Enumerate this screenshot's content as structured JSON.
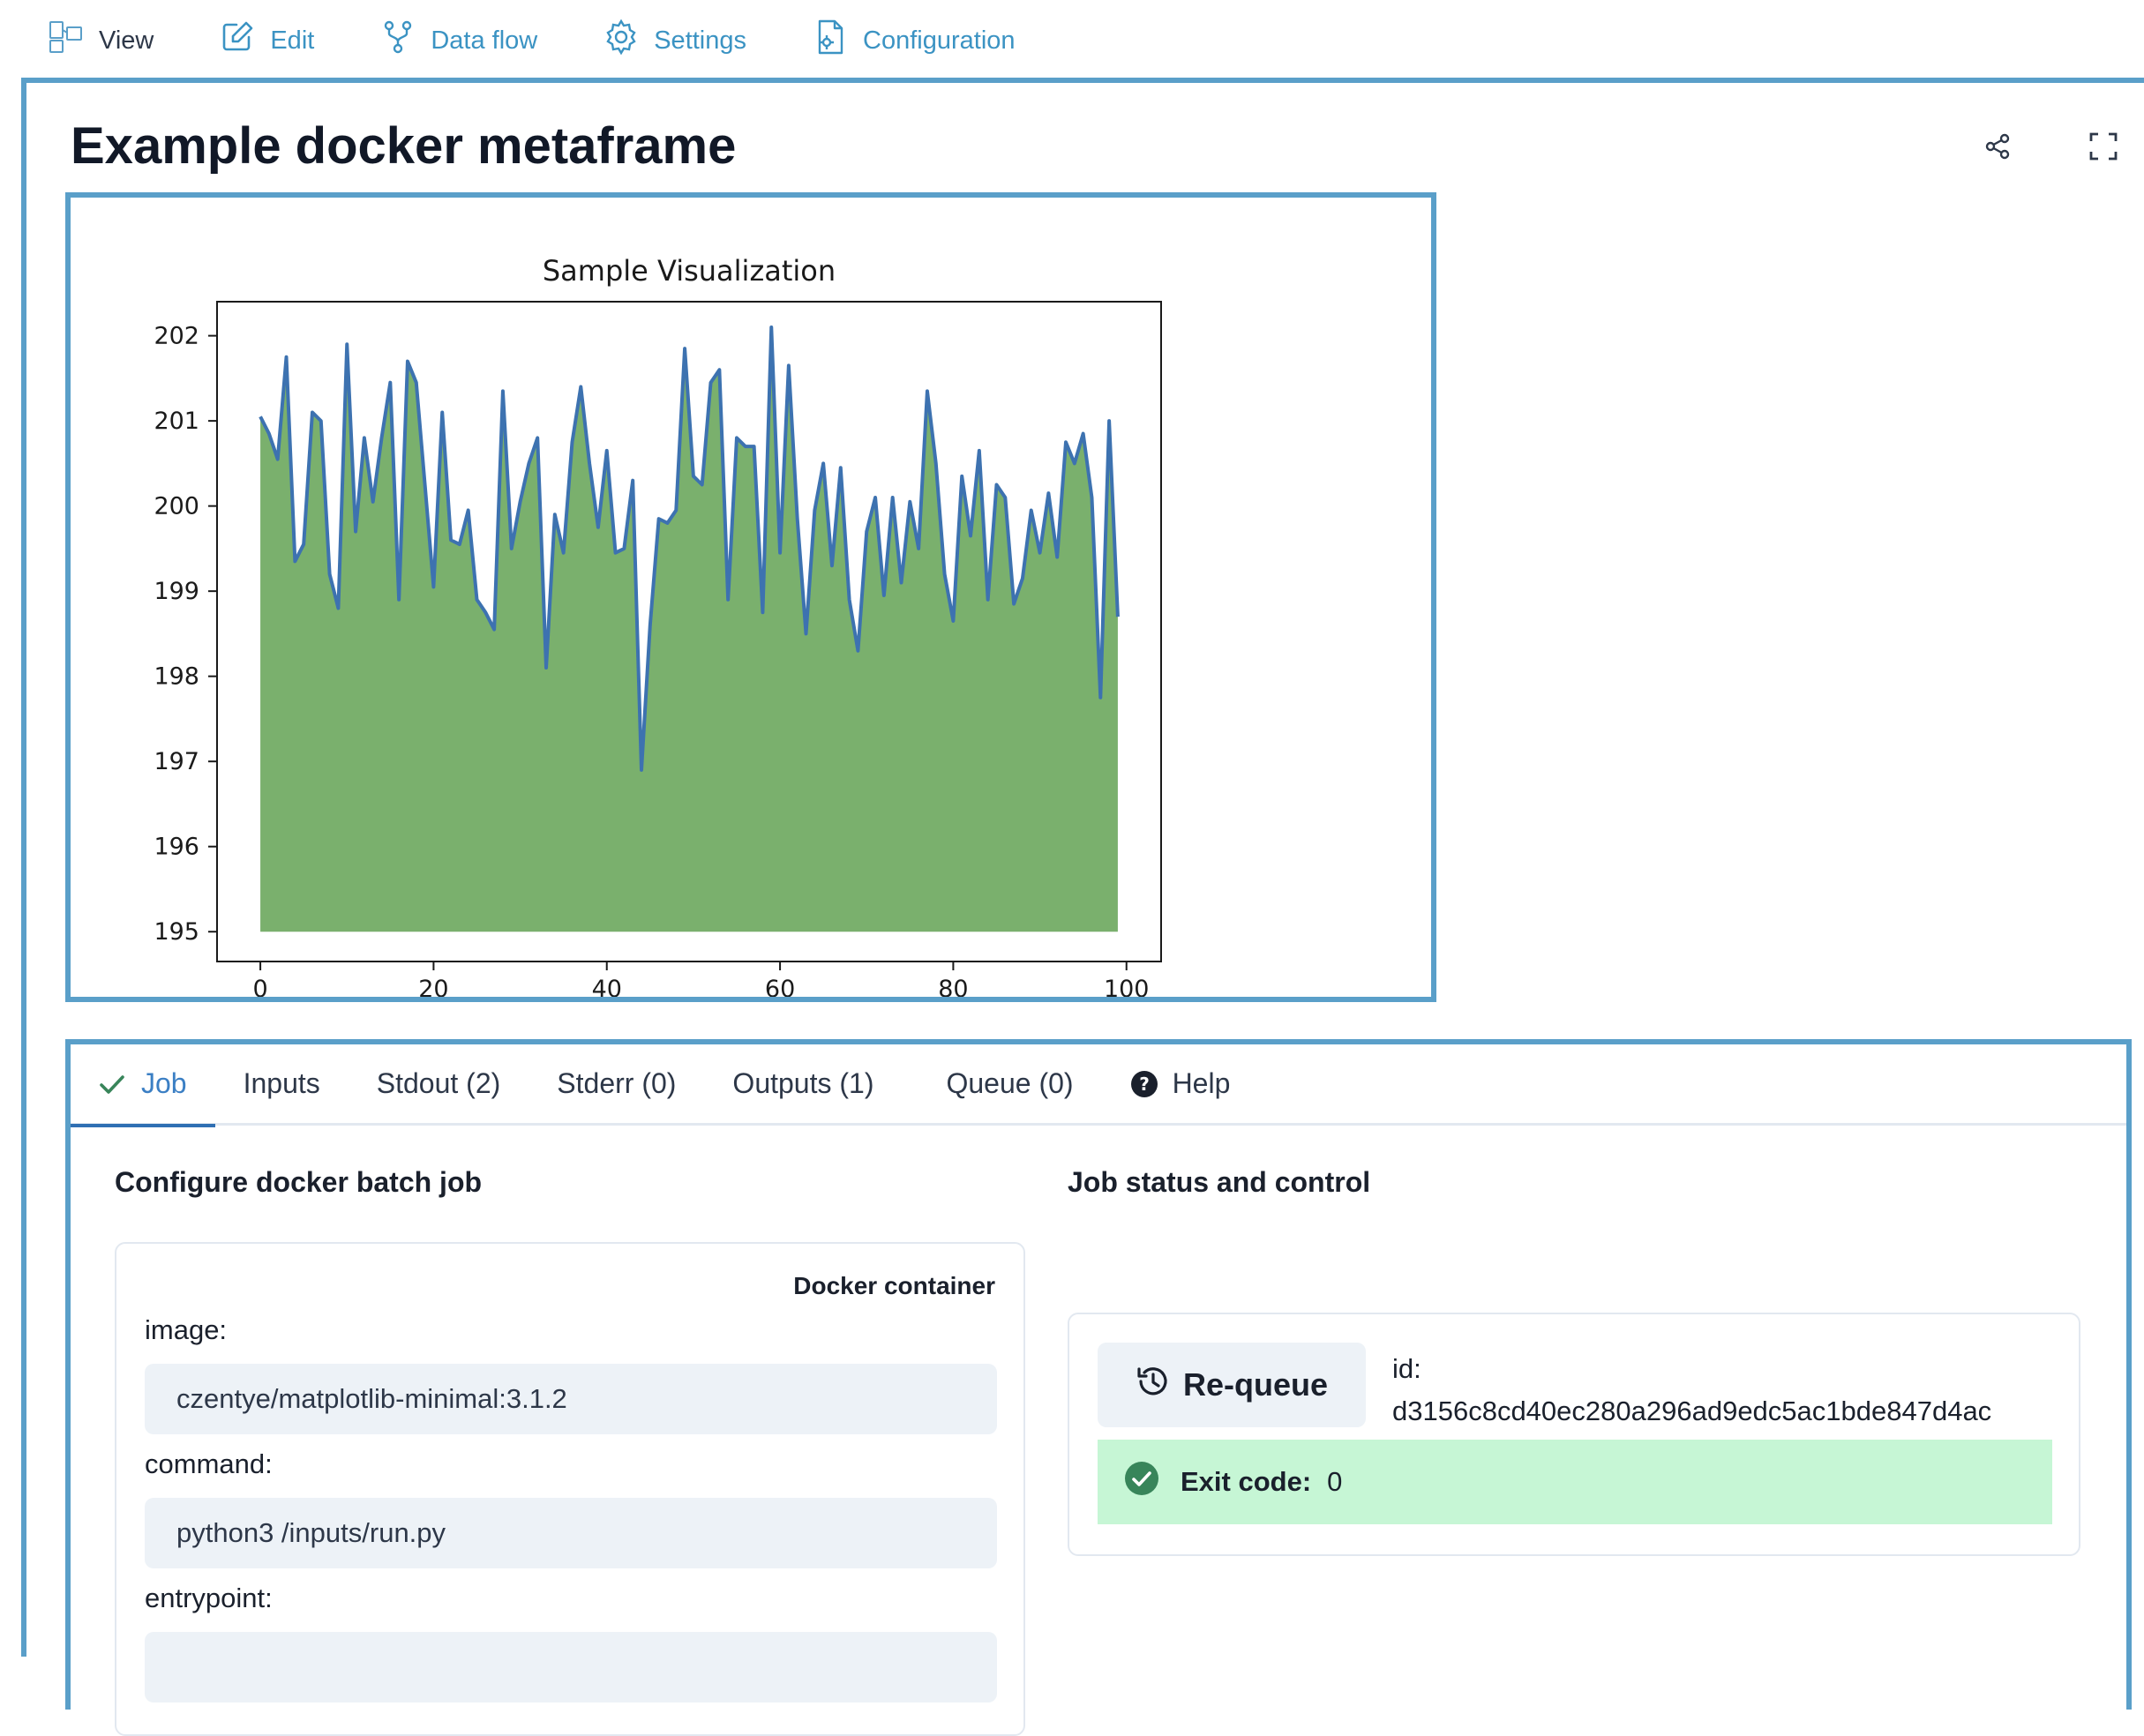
{
  "nav": {
    "items": [
      {
        "label": "View",
        "icon": "view-icon"
      },
      {
        "label": "Edit",
        "icon": "edit-icon"
      },
      {
        "label": "Data flow",
        "icon": "data-flow-icon"
      },
      {
        "label": "Settings",
        "icon": "settings-icon"
      },
      {
        "label": "Configuration",
        "icon": "configuration-icon"
      }
    ],
    "active_color": "#2d3748",
    "link_color": "#3b93c3"
  },
  "page": {
    "title": "Example docker metaframe",
    "frame_color": "#5a9fc9"
  },
  "chart_data": {
    "type": "area",
    "title": "Sample Visualization",
    "xlabel": "",
    "ylabel": "",
    "xlim": [
      -5,
      104
    ],
    "ylim": [
      194.65,
      202.4
    ],
    "xticks": [
      0,
      20,
      40,
      60,
      80,
      100
    ],
    "yticks": [
      195,
      196,
      197,
      198,
      199,
      200,
      201,
      202
    ],
    "baseline": 195,
    "fill_color": "#7ab06d",
    "line_color": "#3d72b0",
    "grid": false,
    "x": [
      0,
      1,
      2,
      3,
      4,
      5,
      6,
      7,
      8,
      9,
      10,
      11,
      12,
      13,
      14,
      15,
      16,
      17,
      18,
      19,
      20,
      21,
      22,
      23,
      24,
      25,
      26,
      27,
      28,
      29,
      30,
      31,
      32,
      33,
      34,
      35,
      36,
      37,
      38,
      39,
      40,
      41,
      42,
      43,
      44,
      45,
      46,
      47,
      48,
      49,
      50,
      51,
      52,
      53,
      54,
      55,
      56,
      57,
      58,
      59,
      60,
      61,
      62,
      63,
      64,
      65,
      66,
      67,
      68,
      69,
      70,
      71,
      72,
      73,
      74,
      75,
      76,
      77,
      78,
      79,
      80,
      81,
      82,
      83,
      84,
      85,
      86,
      87,
      88,
      89,
      90,
      91,
      92,
      93,
      94,
      95,
      96,
      97,
      98,
      99
    ],
    "values": [
      201.05,
      200.85,
      200.55,
      201.75,
      199.35,
      199.55,
      201.1,
      201.0,
      199.2,
      198.8,
      201.9,
      199.7,
      200.8,
      200.05,
      200.8,
      201.45,
      198.9,
      201.7,
      201.45,
      200.25,
      199.05,
      201.1,
      199.6,
      199.55,
      199.95,
      198.9,
      198.75,
      198.55,
      201.35,
      199.5,
      200.05,
      200.5,
      200.8,
      198.1,
      199.9,
      199.45,
      200.75,
      201.4,
      200.5,
      199.75,
      200.65,
      199.45,
      199.5,
      200.3,
      196.9,
      198.6,
      199.85,
      199.8,
      199.95,
      201.85,
      200.35,
      200.25,
      201.45,
      201.6,
      198.9,
      200.8,
      200.7,
      200.7,
      198.75,
      202.1,
      199.45,
      201.65,
      199.85,
      198.5,
      199.95,
      200.5,
      199.3,
      200.45,
      198.9,
      198.3,
      199.7,
      200.1,
      198.95,
      200.1,
      199.1,
      200.05,
      199.5,
      201.35,
      200.5,
      199.2,
      198.65,
      200.35,
      199.65,
      200.65,
      198.9,
      200.25,
      200.1,
      198.85,
      199.15,
      199.95,
      199.45,
      200.15,
      199.4,
      200.75,
      200.5,
      200.85,
      200.1,
      197.75,
      201.0,
      198.7
    ]
  },
  "job": {
    "tabs": [
      {
        "label": "Job"
      },
      {
        "label": "Inputs"
      },
      {
        "label": "Stdout (2)"
      },
      {
        "label": "Stderr (0)"
      },
      {
        "label": "Outputs (1)"
      },
      {
        "label": "Queue (0)"
      },
      {
        "label": "Help"
      }
    ],
    "configure_title": "Configure docker batch job",
    "container_caption": "Docker container",
    "fields": {
      "image_label": "image:",
      "image_value": "czentye/matplotlib-minimal:3.1.2",
      "command_label": "command:",
      "command_value": "python3 /inputs/run.py",
      "entrypoint_label": "entrypoint:",
      "entrypoint_value": ""
    },
    "status_title": "Job status and control",
    "requeue_label": "Re-queue",
    "id_label": "id:",
    "id_value": "d3156c8cd40ec280a296ad9edc5ac1bde847d4ac",
    "exit_label": "Exit code:",
    "exit_value": "0",
    "success_color": "#c6f6d5",
    "check_color": "#38855a"
  }
}
